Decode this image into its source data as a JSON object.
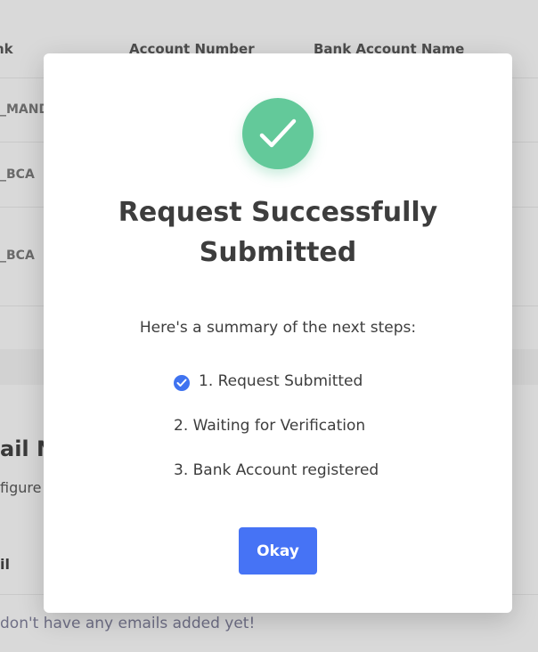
{
  "background": {
    "table": {
      "headers": [
        "nk",
        "Account Number",
        "Bank Account Name"
      ],
      "rows": [
        "_MAND",
        "_BCA",
        "_BCA"
      ]
    },
    "email_section": {
      "title": "ail N",
      "subtitle": "figure",
      "column_label": "il",
      "empty_text": "don't have any emails added yet!"
    }
  },
  "modal": {
    "title": "Request Successfully Submitted",
    "summary": "Here's a summary of the next steps:",
    "steps": [
      {
        "label": "1. Request Submitted",
        "done": true
      },
      {
        "label": "2. Waiting for Verification",
        "done": false
      },
      {
        "label": "3. Bank Account registered",
        "done": false
      }
    ],
    "okay_label": "Okay"
  },
  "colors": {
    "success": "#63c99a",
    "primary": "#4673f5",
    "check": "#3f73f0"
  },
  "icons": {
    "success": "checkmark-circle-icon",
    "step_done": "check-circle-icon"
  }
}
